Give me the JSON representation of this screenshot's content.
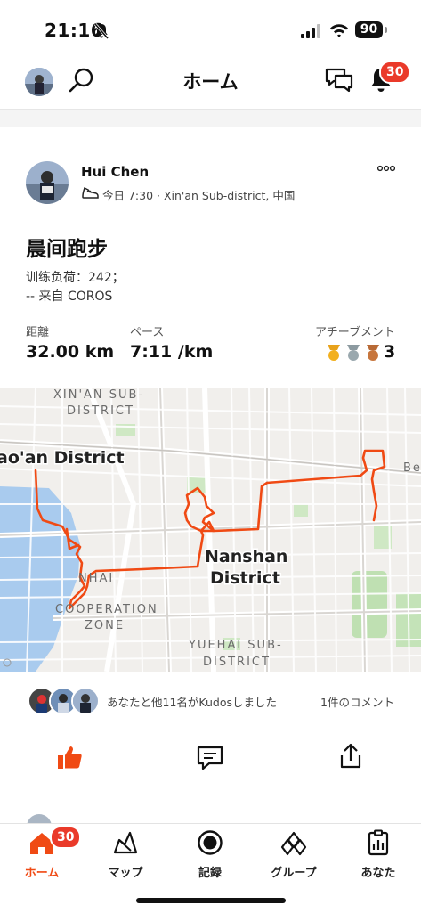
{
  "status_bar": {
    "time": "21:16",
    "battery": "90",
    "icons": [
      "bell-slash-icon",
      "cellular-signal-icon",
      "wifi-icon",
      "battery-icon"
    ]
  },
  "header": {
    "title": "ホーム",
    "notification_count": "30",
    "icons": [
      "profile-avatar",
      "search-icon",
      "chat-icon",
      "bell-icon"
    ]
  },
  "post": {
    "author": "Hui Chen",
    "meta": "今日 7:30 · Xin'an Sub-district, 中国",
    "activity_title": "晨间跑步",
    "description_line1": "训练负荷：242；",
    "description_line2": "-- 来自 COROS",
    "stats": {
      "distance_label": "距離",
      "distance_value": "32.00 km",
      "pace_label": "ペース",
      "pace_value": "7:11 /km",
      "achievements_label": "アチーブメント",
      "achievements_value": "3"
    },
    "map_labels": {
      "xinan1": "XIN'AN SUB-",
      "xinan2": "DISTRICT",
      "baoan": "ao'an District",
      "nanshan1": "Nanshan",
      "nanshan2": "District",
      "hanhai": "NHAI",
      "cooperation": "COOPERATION",
      "zone": "ZONE",
      "yuehai1": "YUEHAI SUB-",
      "yuehai2": "DISTRICT",
      "bei": "Bei"
    },
    "kudos_text": "あなたと他11名がKudosしました",
    "comments_text": "1件のコメント",
    "route_color": "#f04a14"
  },
  "tabbar": {
    "home_label": "ホーム",
    "home_badge": "30",
    "map_label": "マップ",
    "record_label": "記録",
    "groups_label": "グループ",
    "you_label": "あなた",
    "active_color": "#f04a14"
  }
}
